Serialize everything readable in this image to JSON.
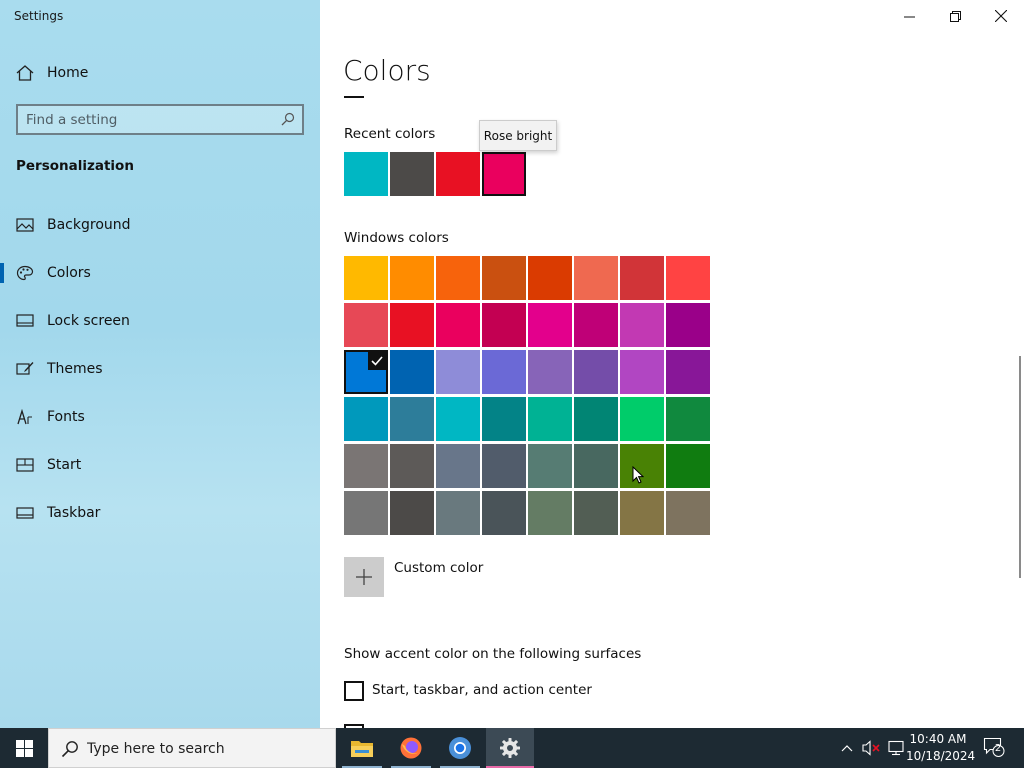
{
  "window": {
    "title": "Settings",
    "controls": [
      "minimize",
      "restore",
      "close"
    ]
  },
  "sidebar": {
    "home_label": "Home",
    "search_placeholder": "Find a setting",
    "section": "Personalization",
    "items": [
      {
        "label": "Background",
        "icon": "image-icon"
      },
      {
        "label": "Colors",
        "icon": "palette-icon",
        "active": true
      },
      {
        "label": "Lock screen",
        "icon": "lock-screen-icon"
      },
      {
        "label": "Themes",
        "icon": "brush-icon"
      },
      {
        "label": "Fonts",
        "icon": "font-icon"
      },
      {
        "label": "Start",
        "icon": "start-icon"
      },
      {
        "label": "Taskbar",
        "icon": "taskbar-icon"
      }
    ]
  },
  "main": {
    "title": "Colors",
    "recent_heading": "Recent colors",
    "recent_colors": [
      "#00b7c3",
      "#4c4a48",
      "#e81123",
      "#ea005e"
    ],
    "recent_selected_index": 3,
    "tooltip": "Rose bright",
    "windows_heading": "Windows colors",
    "windows_colors": [
      [
        "#ffb900",
        "#ff8c00",
        "#f7630c",
        "#ca5010",
        "#da3b01",
        "#ef6950",
        "#d13438",
        "#ff4343"
      ],
      [
        "#e74856",
        "#e81123",
        "#ea005e",
        "#c30052",
        "#e3008c",
        "#bf0077",
        "#c239b3",
        "#9a0089"
      ],
      [
        "#0078d7",
        "#0063b1",
        "#8e8cd8",
        "#6b69d6",
        "#8764b8",
        "#744da9",
        "#b146c2",
        "#881798"
      ],
      [
        "#0099bc",
        "#2d7d9a",
        "#00b7c3",
        "#038387",
        "#00b294",
        "#018574",
        "#00cc6a",
        "#10893e"
      ],
      [
        "#7a7574",
        "#5d5a58",
        "#68768a",
        "#515c6b",
        "#567c73",
        "#486860",
        "#498205",
        "#107c10"
      ],
      [
        "#767676",
        "#4c4a48",
        "#69797e",
        "#4a5459",
        "#647c64",
        "#525e54",
        "#847545",
        "#7e735f"
      ]
    ],
    "selected_swatch": {
      "row": 2,
      "col": 0
    },
    "custom_color_label": "Custom color",
    "surfaces_heading": "Show accent color on the following surfaces",
    "checkboxes": [
      {
        "label": "Start, taskbar, and action center",
        "checked": false
      }
    ]
  },
  "taskbar": {
    "search_placeholder": "Type here to search",
    "apps": [
      "file-explorer",
      "firefox",
      "chrome",
      "settings"
    ],
    "active_app": "settings",
    "time": "10:40 AM",
    "date": "10/18/2024",
    "notification_count": "2"
  }
}
